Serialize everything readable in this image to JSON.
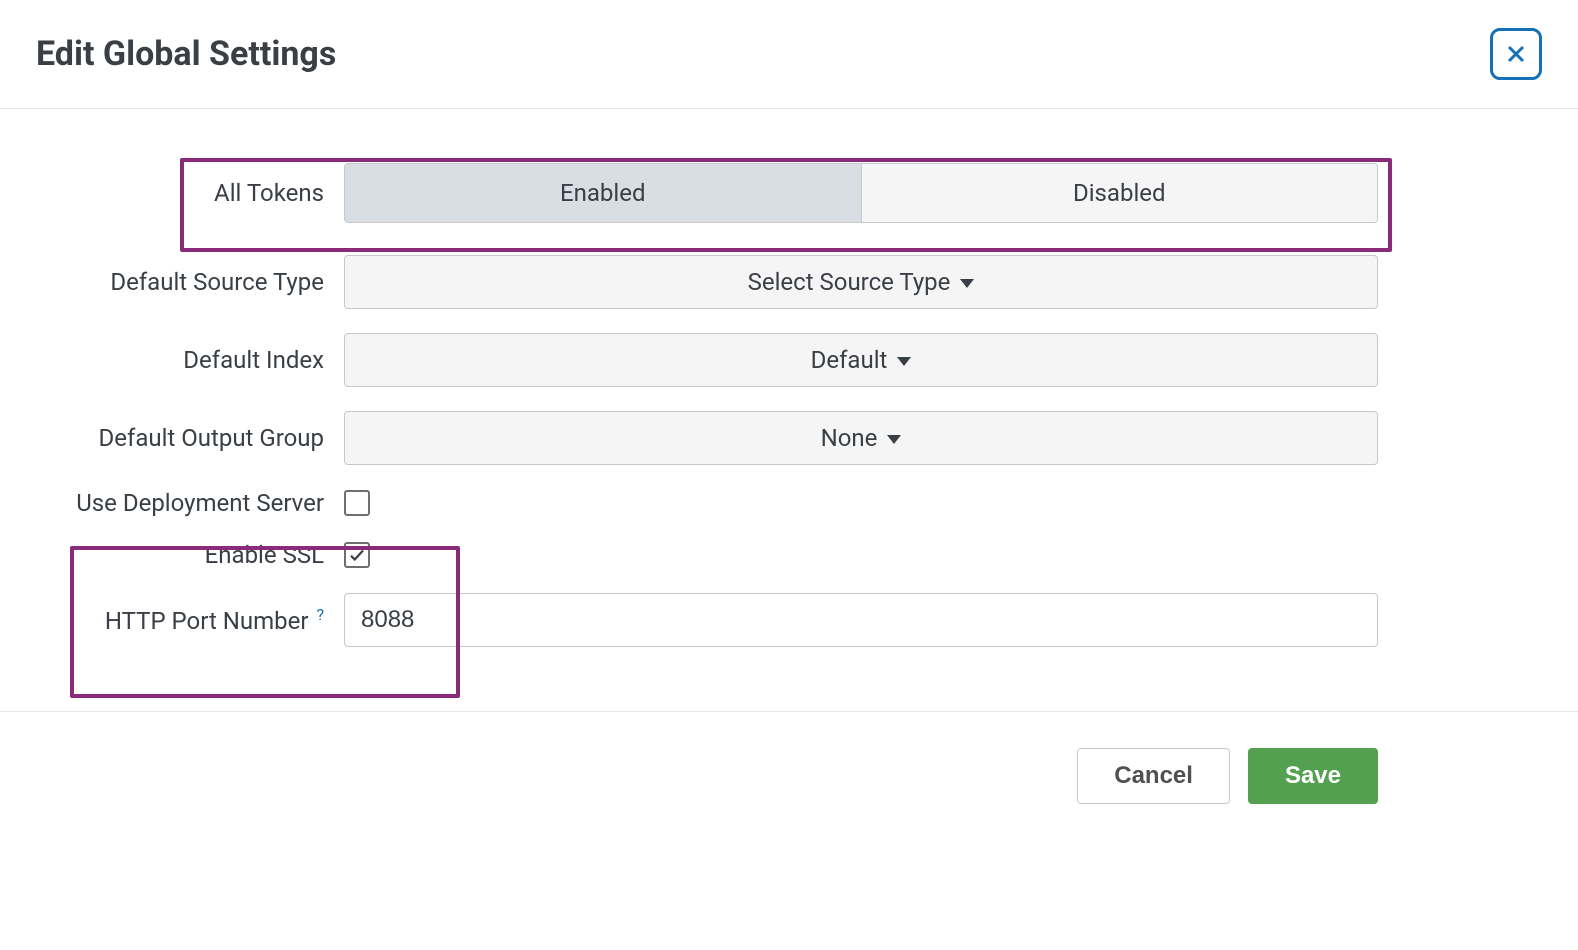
{
  "dialog": {
    "title": "Edit Global Settings"
  },
  "fields": {
    "all_tokens": {
      "label": "All Tokens",
      "options": {
        "enabled": "Enabled",
        "disabled": "Disabled"
      },
      "selected": "enabled"
    },
    "default_source_type": {
      "label": "Default Source Type",
      "value": "Select Source Type"
    },
    "default_index": {
      "label": "Default Index",
      "value": "Default"
    },
    "default_output_group": {
      "label": "Default Output Group",
      "value": "None"
    },
    "use_deployment_server": {
      "label": "Use Deployment Server",
      "checked": false
    },
    "enable_ssl": {
      "label": "Enable SSL",
      "checked": true
    },
    "http_port_number": {
      "label": "HTTP Port Number",
      "help": "?",
      "value": "8088"
    }
  },
  "footer": {
    "cancel": "Cancel",
    "save": "Save"
  }
}
